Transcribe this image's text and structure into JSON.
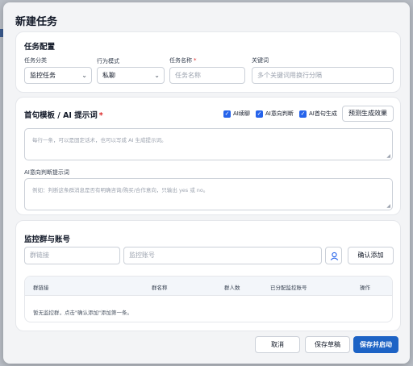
{
  "dialog": {
    "title": "新建任务"
  },
  "task_config": {
    "title": "任务配置",
    "category": {
      "label": "任务分类",
      "value": "监控任务"
    },
    "mode": {
      "label": "行为模式",
      "value": "私聊"
    },
    "name": {
      "label": "任务名称",
      "required_mark": "*",
      "placeholder": "任务名称"
    },
    "keywords": {
      "label": "关键词",
      "placeholder": "多个关键词用换行分隔"
    }
  },
  "template": {
    "title": "首句模板 / AI 提示词",
    "required_mark": "*",
    "checkboxes": [
      {
        "label": "AI续聊",
        "checked": true
      },
      {
        "label": "AI意向判断",
        "checked": true
      },
      {
        "label": "AI首句生成",
        "checked": true
      }
    ],
    "preview_button": "预测生成效果",
    "template_placeholder": "每行一条，可以是固定话术，也可以写成 AI 生成提示词。",
    "intent_label": "AI意向判断提示词",
    "intent_placeholder": "例如：判断这条群消息是否有明确咨询/购买/合作意向，只输出 yes 或 no。"
  },
  "monitor": {
    "title": "监控群与账号",
    "group_link_placeholder": "群链接",
    "account_placeholder": "监控账号",
    "confirm_button": "确认添加",
    "columns": [
      "群链接",
      "群名称",
      "群人数",
      "已分配监控账号",
      "操作"
    ],
    "empty_text": "暂无监控群，点击\"确认添加\"添加第一条。"
  },
  "footer": {
    "cancel": "取消",
    "save_draft": "保存草稿",
    "save_start": "保存并启动"
  },
  "colors": {
    "primary": "#1d63c5",
    "required": "#dc2626",
    "checkbox": "#2563eb"
  }
}
